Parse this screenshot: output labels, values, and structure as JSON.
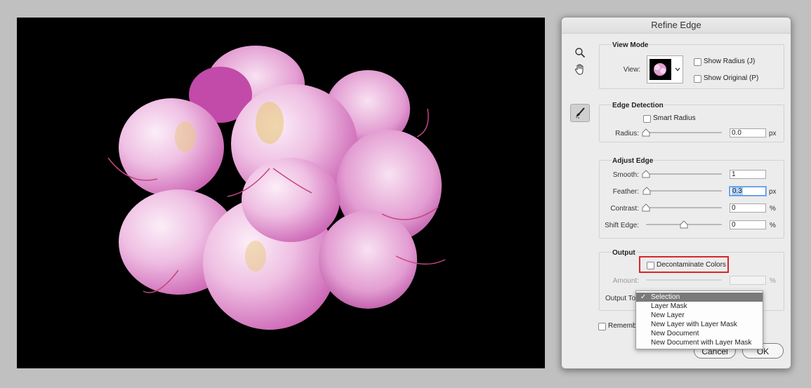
{
  "canvas": {
    "background": "#000000",
    "subject": "pink-flower-cluster"
  },
  "dialog": {
    "title": "Refine Edge",
    "tools": {
      "zoom_icon": "zoom-icon",
      "hand_icon": "hand-icon",
      "brush_icon": "refine-radius-brush-icon"
    },
    "view_mode": {
      "title": "View Mode",
      "view_label": "View:",
      "show_radius": "Show Radius (J)",
      "show_original": "Show Original (P)"
    },
    "edge_detection": {
      "title": "Edge Detection",
      "smart_radius": "Smart Radius",
      "radius_label": "Radius:",
      "radius_value": "0.0",
      "radius_unit": "px",
      "radius_level": 0
    },
    "adjust_edge": {
      "title": "Adjust Edge",
      "smooth_label": "Smooth:",
      "smooth_value": "1",
      "smooth_level": 0,
      "feather_label": "Feather:",
      "feather_value": "0.3",
      "feather_unit": "px",
      "feather_level": 0.01,
      "contrast_label": "Contrast:",
      "contrast_value": "0",
      "contrast_unit": "%",
      "contrast_level": 0,
      "shift_label": "Shift Edge:",
      "shift_value": "0",
      "shift_unit": "%",
      "shift_level": 0.5
    },
    "output": {
      "title": "Output",
      "decontaminate": "Decontaminate Colors",
      "amount_label": "Amount:",
      "amount_unit": "%",
      "output_to_label": "Output To",
      "menu_items": [
        "Selection",
        "Layer Mask",
        "New Layer",
        "New Layer with Layer Mask",
        "New Document",
        "New Document with Layer Mask"
      ],
      "selected_index": 0,
      "check_mark": "✓"
    },
    "remember_label": "Remember",
    "cancel_label": "Cancel",
    "ok_label": "OK"
  },
  "colors": {
    "highlight_box": "#d8262a",
    "menu_active": "#7a7a7a",
    "focus": "#4a90e2",
    "petal_pink": "#e9a3d6"
  }
}
